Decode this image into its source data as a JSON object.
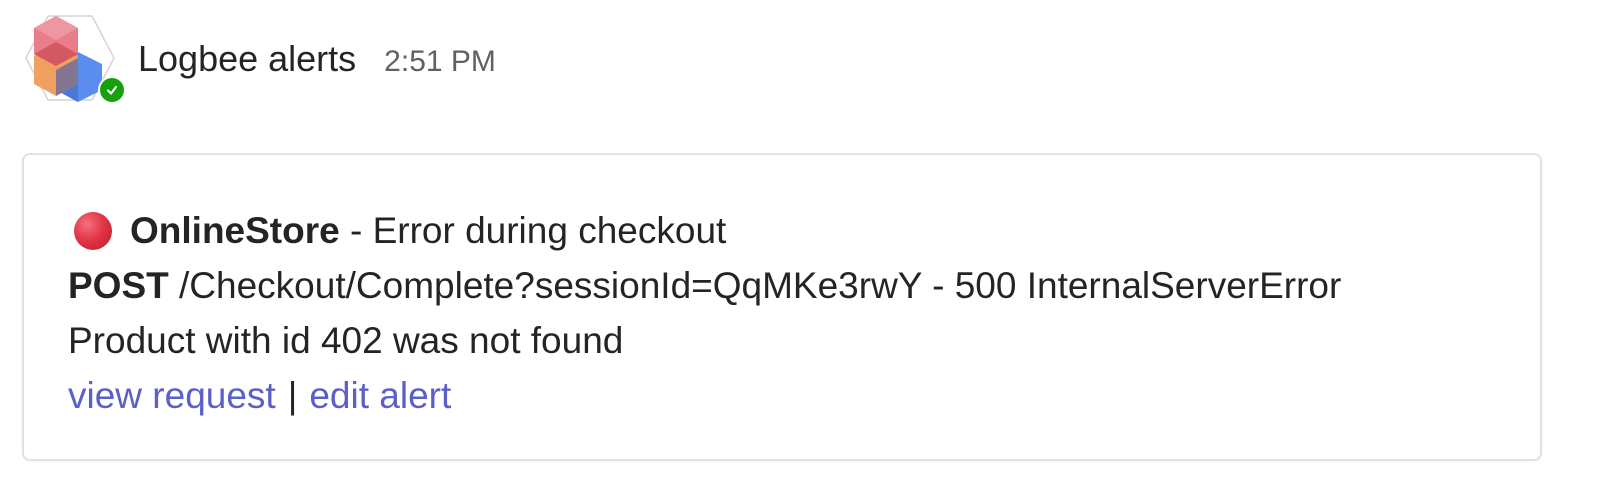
{
  "header": {
    "sender": "Logbee alerts",
    "timestamp": "2:51 PM",
    "avatar_icon": "logbee-logo-icon",
    "presence_icon": "check-icon",
    "presence_color": "#13a10e"
  },
  "card": {
    "status_icon": "red-circle-icon",
    "status_color": "#e23647",
    "app_name": "OnlineStore",
    "title_suffix": " - Error during checkout",
    "method": "POST",
    "request": " /Checkout/Complete?sessionId=QqMKe3rwY - 500 InternalServerError",
    "message": "Product with id 402 was not found",
    "links": {
      "view_request": "view request",
      "separator": "|",
      "edit_alert": "edit alert"
    },
    "link_color": "#5b5fc7"
  }
}
